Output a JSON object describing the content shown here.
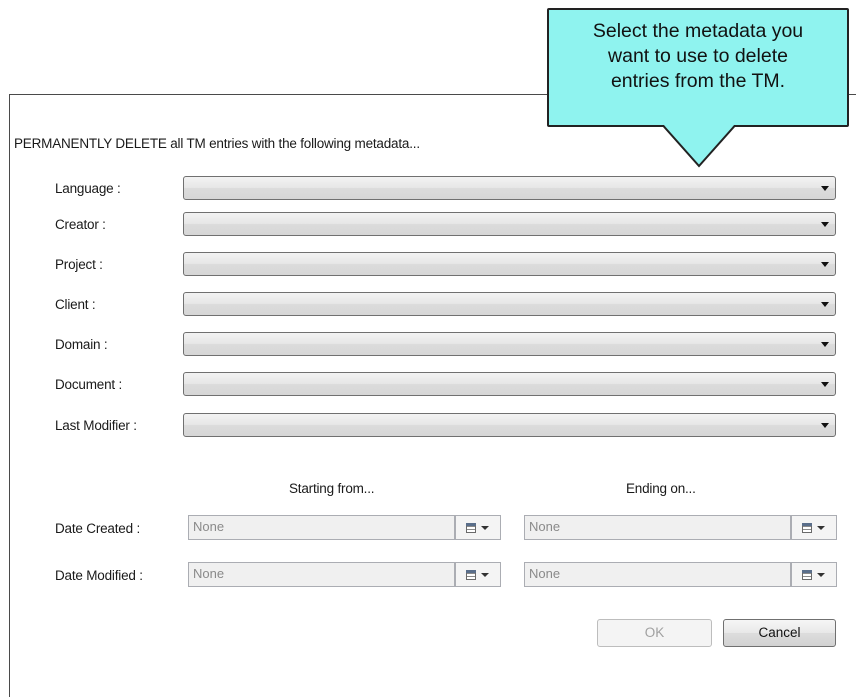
{
  "dialog": {
    "header": "PERMANENTLY DELETE all TM entries with the following metadata...",
    "fields": [
      {
        "label": "Language :",
        "value": ""
      },
      {
        "label": "Creator :",
        "value": ""
      },
      {
        "label": "Project :",
        "value": ""
      },
      {
        "label": "Client :",
        "value": ""
      },
      {
        "label": "Domain :",
        "value": ""
      },
      {
        "label": "Document :",
        "value": ""
      },
      {
        "label": "Last Modifier :",
        "value": ""
      }
    ],
    "date_columns": {
      "start": "Starting from...",
      "end": "Ending on..."
    },
    "date_rows": [
      {
        "label": "Date Created :",
        "start": "None",
        "end": "None"
      },
      {
        "label": "Date Modified :",
        "start": "None",
        "end": "None"
      }
    ],
    "buttons": {
      "ok": "OK",
      "cancel": "Cancel"
    }
  },
  "callout": {
    "lines": [
      "Select the metadata you",
      "want to use to delete",
      "entries from the TM."
    ],
    "color": "#8ff3ef"
  },
  "icons": {
    "dropdown": "chevron-down-icon",
    "calendar": "calendar-icon"
  }
}
